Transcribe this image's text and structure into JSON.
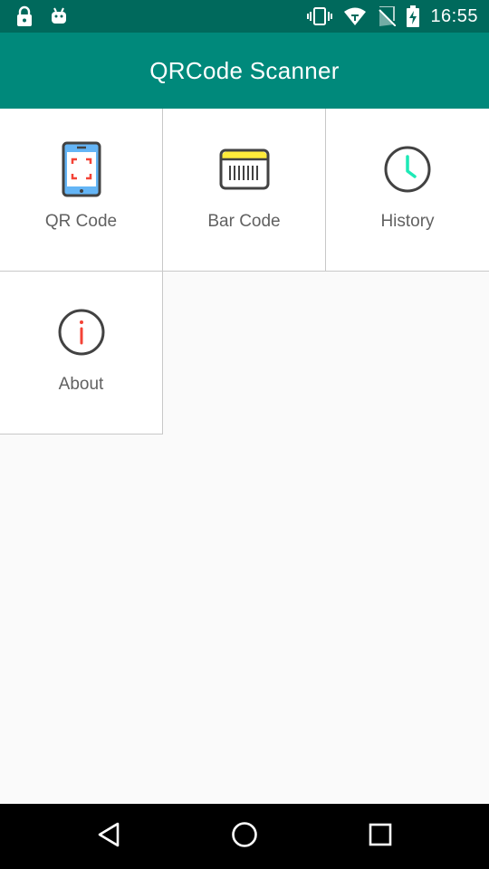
{
  "status_bar": {
    "time": "16:55",
    "left_icons": [
      "lock-icon",
      "android-icon"
    ],
    "right_icons": [
      "vibrate-icon",
      "wifi-icon",
      "no-sim-icon",
      "battery-charging-icon"
    ]
  },
  "app_bar": {
    "title": "QRCode Scanner",
    "color": "#00897b",
    "status_color": "#00695c"
  },
  "menu": {
    "items": [
      {
        "label": "QR Code",
        "icon": "phone-qr-icon"
      },
      {
        "label": "Bar Code",
        "icon": "barcode-icon"
      },
      {
        "label": "History",
        "icon": "clock-icon"
      },
      {
        "label": "About",
        "icon": "info-icon"
      }
    ]
  },
  "nav_bar": {
    "buttons": [
      "back-icon",
      "home-icon",
      "recents-icon"
    ]
  },
  "colors": {
    "accent": "#00897b",
    "accent_dark": "#00695c",
    "icon_red": "#f44336",
    "icon_blue": "#64b5f6",
    "icon_yellow": "#ffeb3b",
    "icon_teal": "#1de9b6"
  }
}
